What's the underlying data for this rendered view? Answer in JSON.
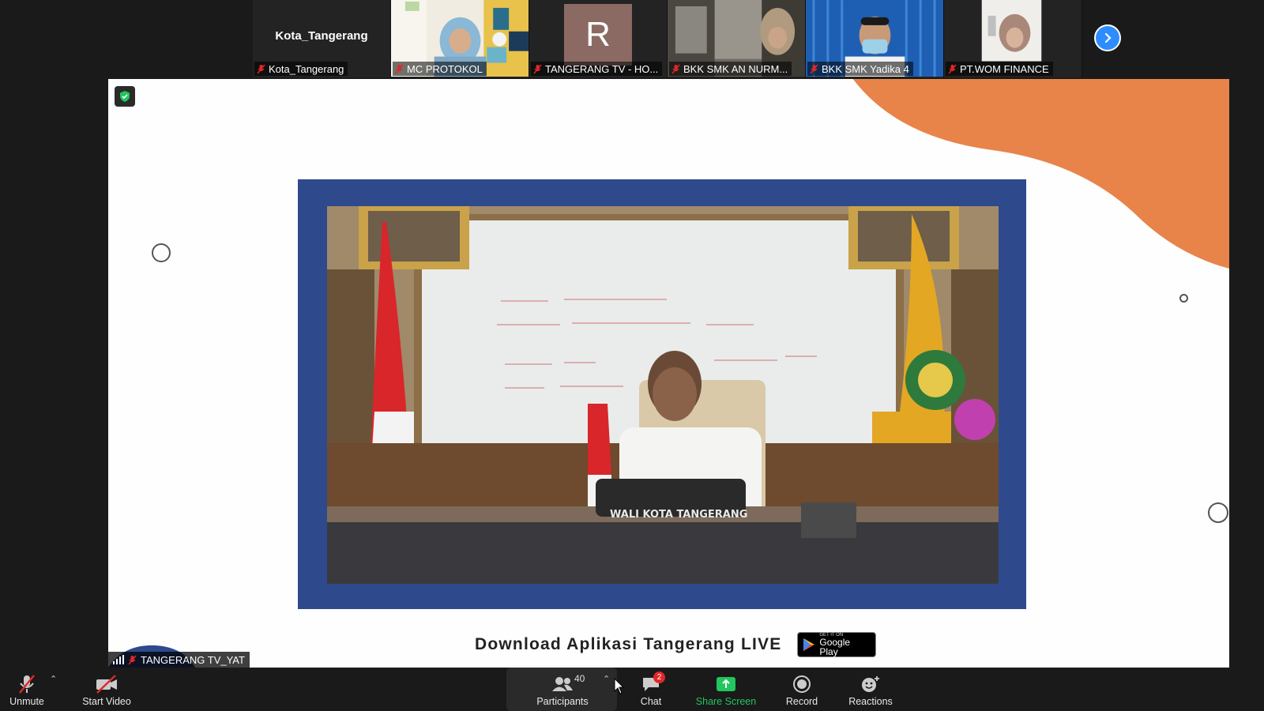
{
  "gallery": {
    "tiles": [
      {
        "title": "Kota_Tangerang",
        "name": "Kota_Tangerang"
      },
      {
        "name": "MC PROTOKOL"
      },
      {
        "initial": "R",
        "name": "TANGERANG TV - HO..."
      },
      {
        "name": "BKK SMK AN NURM..."
      },
      {
        "name": "BKK SMK Yadika 4"
      },
      {
        "name": "PT.WOM FINANCE"
      }
    ]
  },
  "share": {
    "download_text": "Download Aplikasi Tangerang LIVE",
    "badge_small": "GET IT ON",
    "badge_big": "Google Play",
    "nameplate": "WALI KOTA TANGERANG"
  },
  "presenter": {
    "name": "TANGERANG TV_YAT"
  },
  "toolbar": {
    "unmute_label": "Unmute",
    "start_video_label": "Start Video",
    "participants_label": "Participants",
    "participants_count": "40",
    "chat_label": "Chat",
    "chat_badge": "2",
    "share_screen_label": "Share Screen",
    "record_label": "Record",
    "reactions_label": "Reactions"
  },
  "colors": {
    "accent_blue": "#2d8cff",
    "share_green": "#22c55e",
    "muted_red": "#e02828",
    "slide_frame_blue": "#2e4a8c",
    "slide_orange": "#e8844a"
  }
}
